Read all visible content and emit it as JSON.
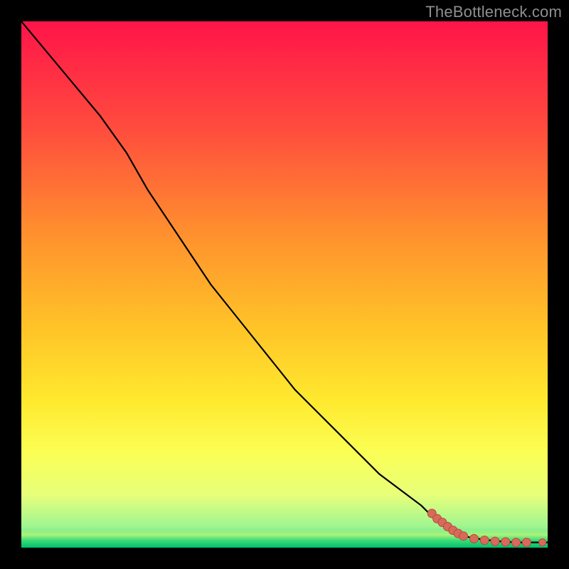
{
  "attribution": "TheBottleneck.com",
  "colors": {
    "gradient_stops": [
      {
        "offset": "0%",
        "color": "#ff1449"
      },
      {
        "offset": "20%",
        "color": "#ff4b3e"
      },
      {
        "offset": "40%",
        "color": "#ff8f2e"
      },
      {
        "offset": "58%",
        "color": "#ffc328"
      },
      {
        "offset": "72%",
        "color": "#ffe92e"
      },
      {
        "offset": "82%",
        "color": "#fbff55"
      },
      {
        "offset": "90%",
        "color": "#e7ff7a"
      },
      {
        "offset": "96%",
        "color": "#9ff591"
      },
      {
        "offset": "100%",
        "color": "#19d07a"
      }
    ],
    "curve": "#000000",
    "points_fill": "#d96a5a",
    "points_stroke": "#b24a3d"
  },
  "chart_data": {
    "type": "line",
    "title": "",
    "xlabel": "",
    "ylabel": "",
    "xlim": [
      0,
      100
    ],
    "ylim": [
      0,
      100
    ],
    "grid": false,
    "series": [
      {
        "name": "bottleneck-curve",
        "x": [
          0,
          5,
          10,
          15,
          20,
          24,
          28,
          32,
          36,
          40,
          44,
          48,
          52,
          56,
          60,
          64,
          68,
          72,
          76,
          79,
          82,
          85,
          88,
          91,
          94,
          97,
          100
        ],
        "y": [
          100,
          94,
          88,
          82,
          75,
          68,
          62,
          56,
          50,
          45,
          40,
          35,
          30,
          26,
          22,
          18,
          14,
          11,
          8,
          5,
          3,
          2,
          1.5,
          1.2,
          1.0,
          1.0,
          1.0
        ]
      }
    ],
    "points": [
      {
        "name": "data-point",
        "x": 78,
        "y": 6.5
      },
      {
        "name": "data-point",
        "x": 79,
        "y": 5.5
      },
      {
        "name": "data-point",
        "x": 80,
        "y": 4.8
      },
      {
        "name": "data-point",
        "x": 81,
        "y": 4.0
      },
      {
        "name": "data-point",
        "x": 82,
        "y": 3.3
      },
      {
        "name": "data-point",
        "x": 83,
        "y": 2.7
      },
      {
        "name": "data-point",
        "x": 84,
        "y": 2.2
      },
      {
        "name": "data-point",
        "x": 86,
        "y": 1.7
      },
      {
        "name": "data-point",
        "x": 88,
        "y": 1.4
      },
      {
        "name": "data-point",
        "x": 90,
        "y": 1.2
      },
      {
        "name": "data-point",
        "x": 92,
        "y": 1.1
      },
      {
        "name": "data-point",
        "x": 94,
        "y": 1.0
      },
      {
        "name": "data-point",
        "x": 96,
        "y": 1.0
      },
      {
        "name": "data-point",
        "x": 99,
        "y": 1.0
      }
    ]
  }
}
